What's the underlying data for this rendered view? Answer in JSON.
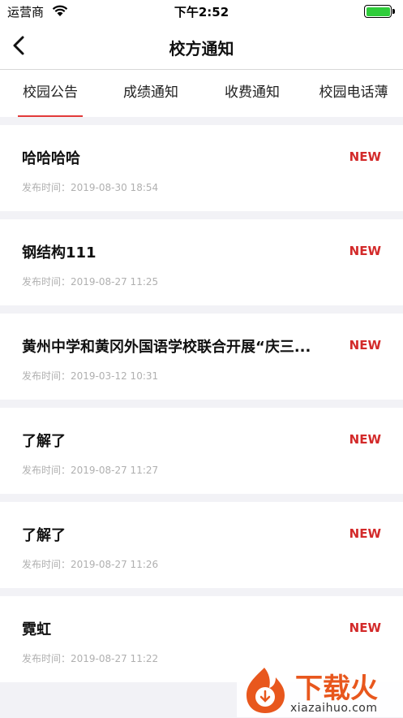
{
  "status": {
    "carrier": "运营商",
    "time": "下午2:52",
    "battery_level": 1.0
  },
  "nav": {
    "title": "校方通知"
  },
  "tabs": [
    {
      "label": "校园公告",
      "active": true
    },
    {
      "label": "成绩通知",
      "active": false
    },
    {
      "label": "收费通知",
      "active": false
    },
    {
      "label": "校园电话薄",
      "active": false
    }
  ],
  "notices": [
    {
      "title": "哈哈哈哈",
      "time": "发布时间：2019-08-30 18:54",
      "badge": "NEW"
    },
    {
      "title": "钢结构111",
      "time": "发布时间：2019-08-27 11:25",
      "badge": "NEW"
    },
    {
      "title": "黄州中学和黄冈外国语学校联合开展“庆三...",
      "time": "发布时间：2019-03-12 10:31",
      "badge": "NEW"
    },
    {
      "title": "了解了",
      "time": "发布时间：2019-08-27 11:27",
      "badge": "NEW"
    },
    {
      "title": "了解了",
      "time": "发布时间：2019-08-27 11:26",
      "badge": "NEW"
    },
    {
      "title": "霓虹",
      "time": "发布时间：2019-08-27 11:22",
      "badge": "NEW"
    }
  ],
  "watermark": {
    "brand": "下载火",
    "site": "xiazaihuo.com"
  },
  "colors": {
    "accent": "#e23a3a",
    "badge": "#d32a2a",
    "battery": "#2ecc3a",
    "watermark": "#e8571d"
  }
}
